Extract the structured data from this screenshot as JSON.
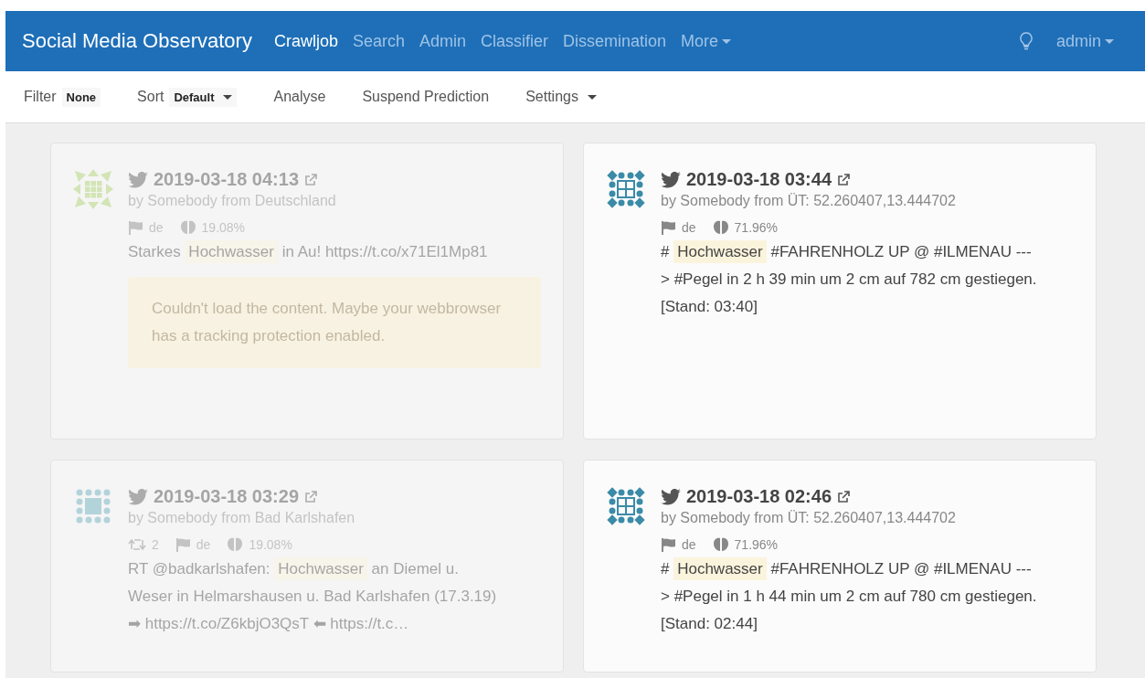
{
  "navbar": {
    "brand": "Social Media Observatory",
    "items": [
      {
        "label": "Crawljob",
        "selected": true,
        "dropdown": false
      },
      {
        "label": "Search",
        "selected": false,
        "dropdown": false
      },
      {
        "label": "Admin",
        "selected": false,
        "dropdown": false
      },
      {
        "label": "Classifier",
        "selected": false,
        "dropdown": false
      },
      {
        "label": "Dissemination",
        "selected": false,
        "dropdown": false
      },
      {
        "label": "More",
        "selected": false,
        "dropdown": true
      }
    ],
    "user": "admin"
  },
  "toolbar": [
    {
      "kind": "value",
      "label": "Filter",
      "value": "None",
      "dropdown": false
    },
    {
      "kind": "value",
      "label": "Sort",
      "value": "Default",
      "dropdown": true
    },
    {
      "kind": "action",
      "label": "Analyse",
      "dropdown": false
    },
    {
      "kind": "action",
      "label": "Suspend Prediction",
      "dropdown": false
    },
    {
      "kind": "action",
      "label": "Settings",
      "dropdown": true
    }
  ],
  "posts": [
    {
      "faded": true,
      "avatar": {
        "kind": "star",
        "color": "#d3e4b5"
      },
      "time": "2019-03-18 04:13",
      "author": "by Somebody from Deutschland",
      "language": "de",
      "score": "19.08%",
      "text": [
        {
          "text": "Starkes ",
          "highlight": false
        },
        {
          "text": "Hochwasser",
          "highlight": true
        },
        {
          "text": " in Au! https://t.co/x71El1Mp81",
          "highlight": false
        }
      ],
      "notice": "Couldn't load the content. Maybe your webbrowser has a tracking protection enabled."
    },
    {
      "faded": false,
      "avatar": {
        "kind": "grid",
        "color": "#3b8ba8"
      },
      "time": "2019-03-18 03:44",
      "author": "by Somebody from ÜT: 52.260407,13.444702",
      "language": "de",
      "score": "71.96%",
      "text": [
        {
          "text": "# ",
          "highlight": false
        },
        {
          "text": "Hochwasser",
          "highlight": true
        },
        {
          "text": " #FAHRENHOLZ UP @ #ILMENAU ---> #Pegel in 2 h 39 min um 2 cm auf 782 cm gestiegen. [Stand: 03:40]",
          "highlight": false
        }
      ]
    },
    {
      "faded": true,
      "avatar": {
        "kind": "square",
        "color": "#b3d3db"
      },
      "time": "2019-03-18 03:29",
      "author": "by Somebody from Bad Karlshafen",
      "retweets": "2",
      "language": "de",
      "score": "19.08%",
      "text": [
        {
          "text": "RT @badkarlshafen: ",
          "highlight": false
        },
        {
          "text": "Hochwasser",
          "highlight": true
        },
        {
          "text": " an Diemel u. Weser in Helmarshausen u. Bad Karlshafen (17.3.19) ➡ https://t.co/Z6kbjO3QsT ⬅ https://t.c…",
          "highlight": false
        }
      ]
    },
    {
      "faded": false,
      "avatar": {
        "kind": "grid",
        "color": "#3b8ba8"
      },
      "time": "2019-03-18 02:46",
      "author": "by Somebody from ÜT: 52.260407,13.444702",
      "language": "de",
      "score": "71.96%",
      "text": [
        {
          "text": "# ",
          "highlight": false
        },
        {
          "text": "Hochwasser",
          "highlight": true
        },
        {
          "text": " #FAHRENHOLZ UP @ #ILMENAU ---> #Pegel in 1 h 44 min um 2 cm auf 780 cm gestiegen. [Stand: 02:44]",
          "highlight": false
        }
      ]
    }
  ]
}
